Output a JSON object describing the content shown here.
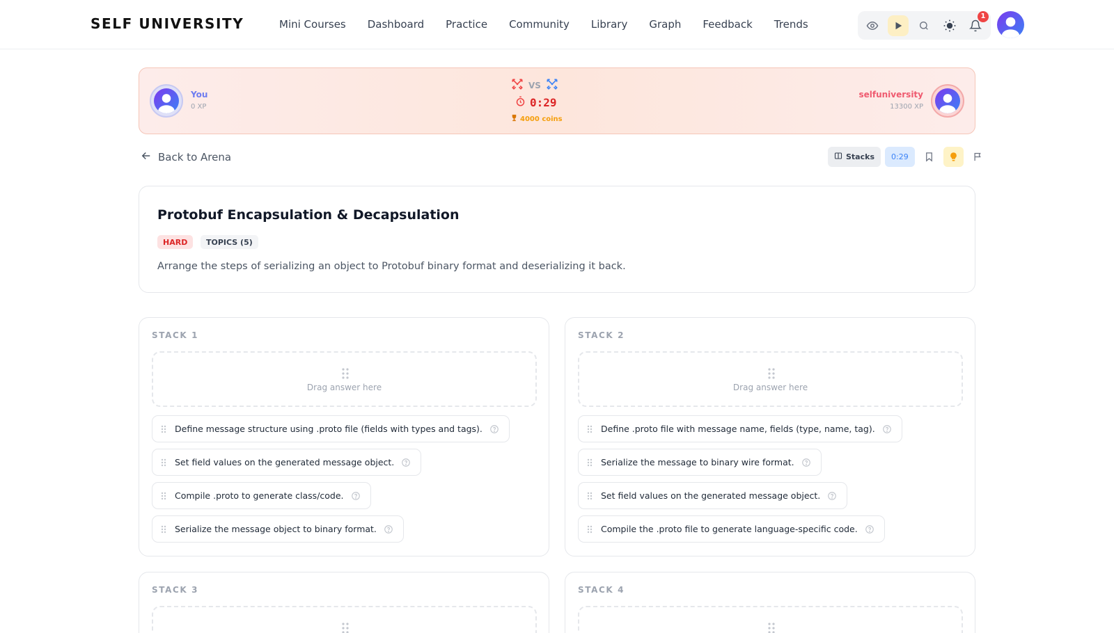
{
  "brand": "SELF UNIVERSITY",
  "nav": {
    "items": [
      "Mini Courses",
      "Dashboard",
      "Practice",
      "Community",
      "Library",
      "Graph",
      "Feedback",
      "Trends"
    ],
    "notification_count": "1"
  },
  "battle": {
    "you": {
      "name": "You",
      "xp": "0 XP"
    },
    "opponent": {
      "name": "selfuniversity",
      "xp": "13300 XP"
    },
    "vs_label": "VS",
    "timer": "0:29",
    "prize": "4000 coins"
  },
  "actions": {
    "back_label": "Back to Arena",
    "stacks_label": "Stacks",
    "timer_pill": "0:29"
  },
  "question": {
    "title": "Protobuf Encapsulation & Decapsulation",
    "difficulty": "HARD",
    "topics": "TOPICS (5)",
    "description": "Arrange the steps of serializing an object to Protobuf binary format and deserializing it back."
  },
  "drop_placeholder": "Drag answer here",
  "stacks": [
    {
      "label": "STACK 1",
      "items": [
        "Define message structure using .proto file (fields with types and tags).",
        "Set field values on the generated message object.",
        "Compile .proto to generate class/code.",
        "Serialize the message object to binary format."
      ]
    },
    {
      "label": "STACK 2",
      "items": [
        "Define .proto file with message name, fields (type, name, tag).",
        "Serialize the message to binary wire format.",
        "Set field values on the generated message object.",
        "Compile the .proto file to generate language-specific code."
      ]
    },
    {
      "label": "STACK 3",
      "items": []
    },
    {
      "label": "STACK 4",
      "items": []
    }
  ],
  "colors": {
    "accent_blue": "#3b82f6",
    "danger_red": "#dc2626",
    "coin_orange": "#f59e0b",
    "avatar_gradient_start": "#7c3aed"
  }
}
